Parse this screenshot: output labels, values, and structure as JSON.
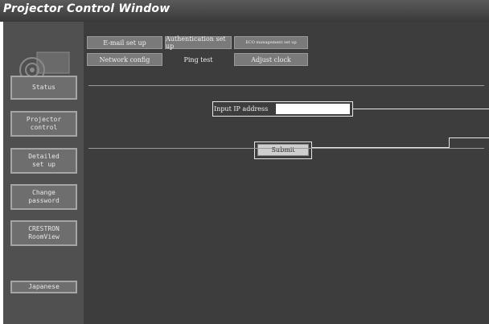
{
  "window": {
    "title": "Projector Control Window"
  },
  "sidebar": {
    "items": [
      {
        "label": "Status"
      },
      {
        "label": "Projector\ncontrol"
      },
      {
        "label": "Detailed\nset up"
      },
      {
        "label": "Change\npassword"
      },
      {
        "label": "CRESTRON\nRoomView"
      },
      {
        "label": "Japanese"
      }
    ]
  },
  "tabs": {
    "row1": [
      {
        "label": "E-mail set up"
      },
      {
        "label": "Authentication set up"
      },
      {
        "label": "ECO management set up"
      }
    ],
    "row2": [
      {
        "label": "Network config"
      },
      {
        "label": "Ping test"
      },
      {
        "label": "Adjust clock"
      }
    ],
    "active": "Ping test"
  },
  "ping": {
    "input_label": "Input IP address",
    "input_value": "",
    "submit_label": "Submit"
  },
  "colors": {
    "sidebar_bg": "#505050",
    "main_bg": "#3d3d3d",
    "button_bg": "#6e6e6e"
  }
}
